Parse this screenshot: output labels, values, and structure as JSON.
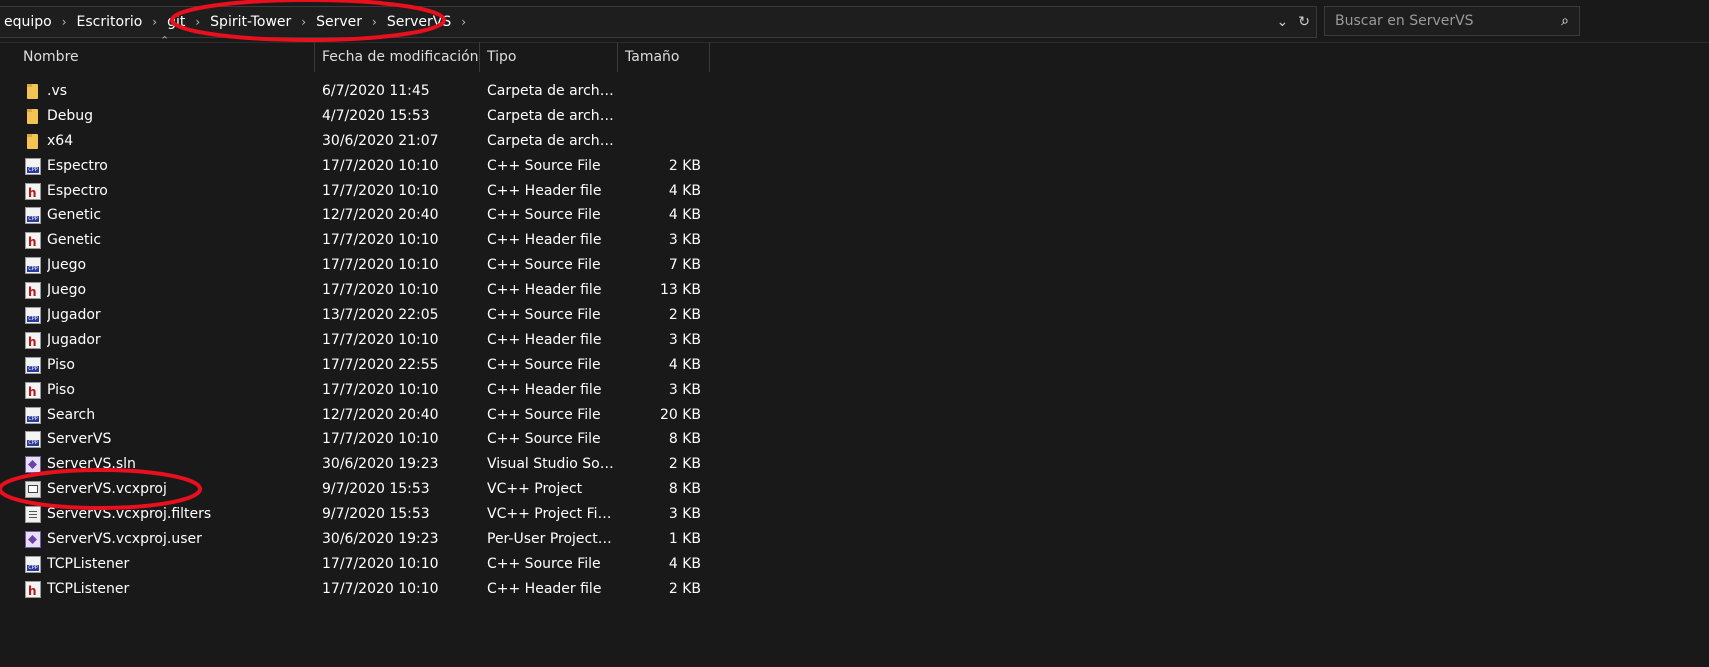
{
  "address_bar": {
    "breadcrumbs": [
      "equipo",
      "Escritorio",
      "git",
      "Spirit-Tower",
      "Server",
      "ServerVS"
    ],
    "dropdown_icon": "chevron-down-icon",
    "refresh_icon": "refresh-icon"
  },
  "search": {
    "placeholder": "Buscar en ServerVS",
    "icon": "search-icon"
  },
  "columns": {
    "name": "Nombre",
    "date": "Fecha de modificación",
    "type": "Tipo",
    "size": "Tamaño"
  },
  "files": [
    {
      "name": ".vs",
      "date": "6/7/2020 11:45",
      "type": "Carpeta de archivos",
      "size": "",
      "icon": "folder"
    },
    {
      "name": "Debug",
      "date": "4/7/2020 15:53",
      "type": "Carpeta de archivos",
      "size": "",
      "icon": "folder"
    },
    {
      "name": "x64",
      "date": "30/6/2020 21:07",
      "type": "Carpeta de archivos",
      "size": "",
      "icon": "folder"
    },
    {
      "name": "Espectro",
      "date": "17/7/2020 10:10",
      "type": "C++ Source File",
      "size": "2 KB",
      "icon": "cpp"
    },
    {
      "name": "Espectro",
      "date": "17/7/2020 10:10",
      "type": "C++ Header file",
      "size": "4 KB",
      "icon": "hdr"
    },
    {
      "name": "Genetic",
      "date": "12/7/2020 20:40",
      "type": "C++ Source File",
      "size": "4 KB",
      "icon": "cpp"
    },
    {
      "name": "Genetic",
      "date": "17/7/2020 10:10",
      "type": "C++ Header file",
      "size": "3 KB",
      "icon": "hdr"
    },
    {
      "name": "Juego",
      "date": "17/7/2020 10:10",
      "type": "C++ Source File",
      "size": "7 KB",
      "icon": "cpp"
    },
    {
      "name": "Juego",
      "date": "17/7/2020 10:10",
      "type": "C++ Header file",
      "size": "13 KB",
      "icon": "hdr"
    },
    {
      "name": "Jugador",
      "date": "13/7/2020 22:05",
      "type": "C++ Source File",
      "size": "2 KB",
      "icon": "cpp"
    },
    {
      "name": "Jugador",
      "date": "17/7/2020 10:10",
      "type": "C++ Header file",
      "size": "3 KB",
      "icon": "hdr"
    },
    {
      "name": "Piso",
      "date": "17/7/2020 22:55",
      "type": "C++ Source File",
      "size": "4 KB",
      "icon": "cpp"
    },
    {
      "name": "Piso",
      "date": "17/7/2020 10:10",
      "type": "C++ Header file",
      "size": "3 KB",
      "icon": "hdr"
    },
    {
      "name": "Search",
      "date": "12/7/2020 20:40",
      "type": "C++ Source File",
      "size": "20 KB",
      "icon": "cpp"
    },
    {
      "name": "ServerVS",
      "date": "17/7/2020 10:10",
      "type": "C++ Source File",
      "size": "8 KB",
      "icon": "cpp"
    },
    {
      "name": "ServerVS.sln",
      "date": "30/6/2020 19:23",
      "type": "Visual Studio Solut...",
      "size": "2 KB",
      "icon": "sln"
    },
    {
      "name": "ServerVS.vcxproj",
      "date": "9/7/2020 15:53",
      "type": "VC++ Project",
      "size": "8 KB",
      "icon": "proj"
    },
    {
      "name": "ServerVS.vcxproj.filters",
      "date": "9/7/2020 15:53",
      "type": "VC++ Project Filte...",
      "size": "3 KB",
      "icon": "filt"
    },
    {
      "name": "ServerVS.vcxproj.user",
      "date": "30/6/2020 19:23",
      "type": "Per-User Project O...",
      "size": "1 KB",
      "icon": "user"
    },
    {
      "name": "TCPListener",
      "date": "17/7/2020 10:10",
      "type": "C++ Source File",
      "size": "4 KB",
      "icon": "cpp"
    },
    {
      "name": "TCPListener",
      "date": "17/7/2020 10:10",
      "type": "C++ Header file",
      "size": "2 KB",
      "icon": "hdr"
    }
  ],
  "colors": {
    "background": "#191919",
    "annotation": "#e8101c"
  }
}
